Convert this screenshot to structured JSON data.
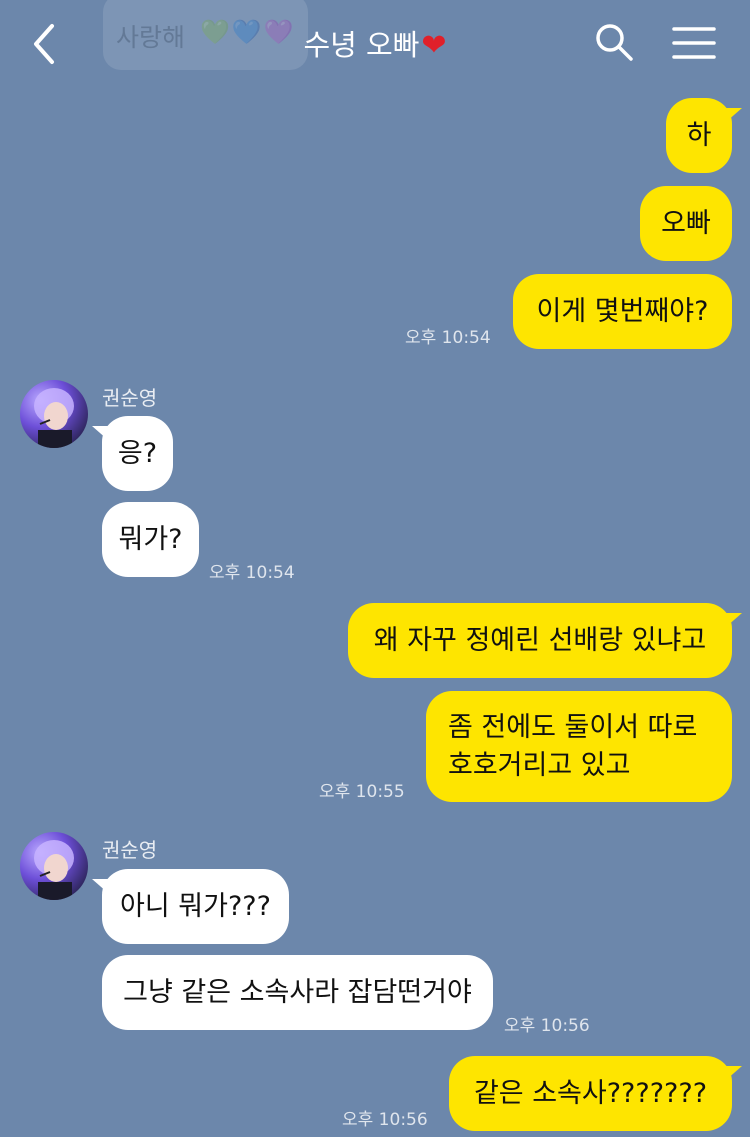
{
  "header": {
    "title": "수녕 오빠",
    "title_heart": "❤️",
    "back_icon": "chevron-left-icon",
    "search_icon": "search-icon",
    "menu_icon": "hamburger-menu-icon",
    "ghost_text": "사랑해",
    "ghost_hearts": "💚💙💜"
  },
  "colors": {
    "background": "#6c87ab",
    "my_bubble": "#fee500",
    "their_bubble": "#ffffff"
  },
  "messages": {
    "m1": "하",
    "m2": "오빠",
    "m3": "이게 몇번째야?",
    "t1": "오후 10:54",
    "sender1": "권순영",
    "m4": "응?",
    "m5": "뭐가?",
    "t2": "오후 10:54",
    "m6": "왜 자꾸 정예린 선배랑 있냐고",
    "m7a": "좀 전에도 둘이서 따로",
    "m7b": "호호거리고 있고",
    "t3": "오후 10:55",
    "sender2": "권순영",
    "m8": "아니 뭐가???",
    "m9": "그냥 같은 소속사라 잡담떤거야",
    "t4": "오후 10:56",
    "m10": "같은 소속사???????",
    "t5": "오후 10:56"
  }
}
